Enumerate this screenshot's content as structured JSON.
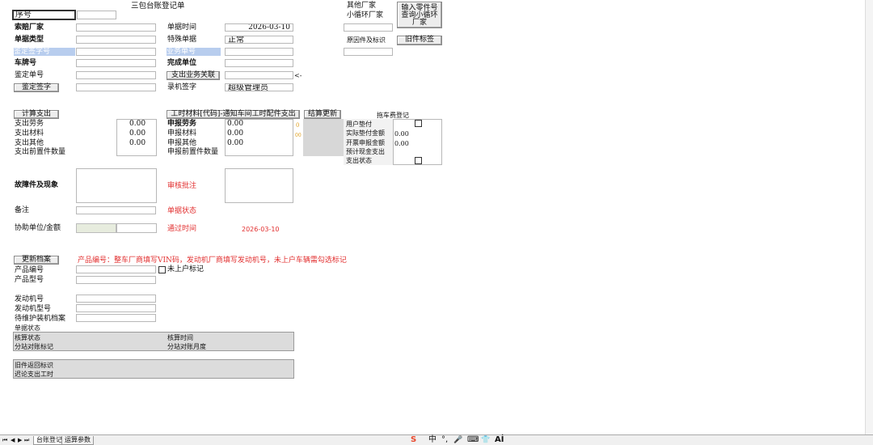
{
  "form_title": "三包台账登记单",
  "header": {
    "seq_label": "序号",
    "seq_value": "",
    "claim_vendor_label": "索赔厂家",
    "doc_type_label": "单据类型",
    "appraisal_sign_no_label": "鉴定签字号",
    "plate_no_label": "车牌号",
    "appraisal_no_label": "鉴定单号",
    "appraisal_sign_button": "鉴定签字",
    "doc_time_label": "单据时间",
    "doc_time_value": "2026-03-10",
    "special_doc_label": "特殊单据",
    "special_doc_value": "正常",
    "business_no_label": "业务单号",
    "complete_unit_label": "完成单位",
    "expense_link_button": "支出业务关联",
    "expense_link_suffix": "<-",
    "entry_sign_label": "录机签字",
    "entry_sign_value": "超级管理员",
    "other_vendor_label": "其他厂家",
    "small_loop_vendor_label": "小循环厂家",
    "query_button": "输入零件号查询小循环厂家",
    "reason_part_label": "原因件及标识",
    "old_part_label_button": "旧件标签"
  },
  "expense": {
    "calc_button": "计算支出",
    "labor_label": "支出劳务",
    "labor_value": "0.00",
    "material_label": "支出材料",
    "material_value": "0.00",
    "other_label": "支出其他",
    "other_value": "0.00",
    "pre_parts_label": "支出前置件数量",
    "hours_button": "工时材料[代码]-通知车间工时配件支出",
    "decl_labor_label": "申报劳务",
    "decl_labor_value": "0.00",
    "decl_material_label": "申报材料",
    "decl_material_value": "0.00",
    "decl_other_label": "申报其他",
    "decl_other_value": "0.00",
    "decl_pre_parts_label": "申报前置件数量",
    "marker_zero": "0",
    "marker_dots": "00",
    "settle_button": "结算更新"
  },
  "towing": {
    "title": "拖车费登记",
    "user_advance_label": "用户垫付",
    "actual_advance_label": "实际垫付金额",
    "actual_advance_value": "0.00",
    "invoice_amount_label": "开票申报金额",
    "invoice_amount_value": "0.00",
    "expected_cash_label": "预计现金支出",
    "expense_status_label": "支出状态"
  },
  "fault": {
    "fault_label": "故障件及现象",
    "audit_label": "审核批注",
    "remark_label": "备注",
    "doc_status_label": "单据状态",
    "assist_label": "协助单位/金额",
    "pass_time_label": "通过时间",
    "pass_time_value": "2026-03-10"
  },
  "product": {
    "update_button": "更新档案",
    "note": "产品编号：整车厂商填写VIN码，发动机厂商填写发动机号，未上户车辆需勾选标记",
    "product_no_label": "产品编号",
    "product_model_label": "产品型号",
    "unregistered_label": "未上户标记",
    "engine_no_label": "发动机号",
    "engine_model_label": "发动机型号",
    "maintenance_label": "待维护装机档案",
    "doc_status_label": "单据状态"
  },
  "audit_group": {
    "audit_status_label": "核算状态",
    "audit_time_label": "核算时间",
    "sub_reconcile_label": "分站对账标记",
    "sub_reconcile_month_label": "分站对账月度"
  },
  "return_group": {
    "old_return_label": "旧件返回标识",
    "delay_labor_label": "迟论支出工时"
  },
  "tabs": [
    "台账登记",
    "运算参数"
  ],
  "nav_arrows": [
    "⏮",
    "◀",
    "▶",
    "⏭"
  ],
  "ime": {
    "logo": "S",
    "chinese": "中",
    "dots": "°,",
    "mic": "🎤",
    "keyboard": "⌨",
    "shirt": "👕",
    "ai": "Aİ"
  }
}
